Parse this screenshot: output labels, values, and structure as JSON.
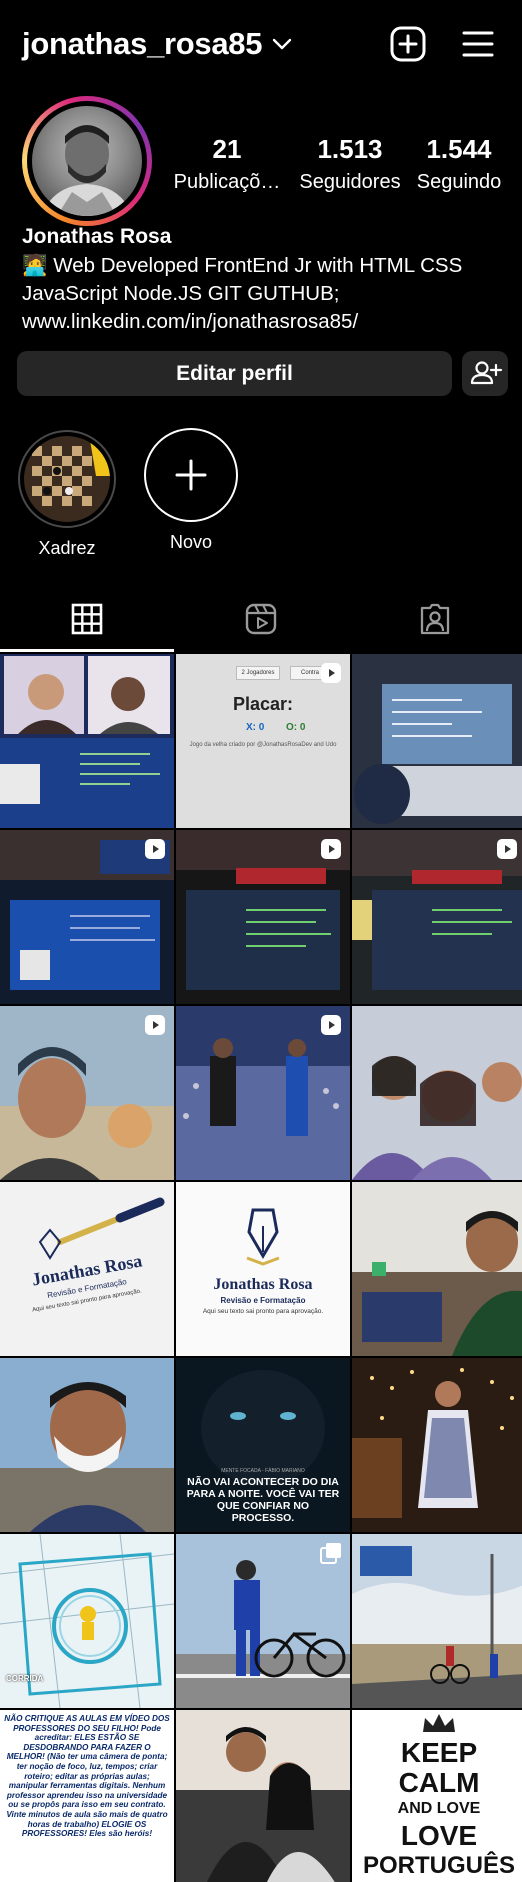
{
  "header": {
    "username": "jonathas_rosa85"
  },
  "profile": {
    "name": "Jonathas Rosa",
    "bio_line1": "🧑‍💻 Web Developed FrontEnd Jr with HTML CSS",
    "bio_line2": "JavaScript Node.JS GIT GUTHUB;",
    "link": "www.linkedin.com/in/jonathasrosa85/",
    "stats": [
      {
        "value": "21",
        "label": "Publicaçõ…"
      },
      {
        "value": "1.513",
        "label": "Seguidores"
      },
      {
        "value": "1.544",
        "label": "Seguindo"
      }
    ]
  },
  "actions": {
    "edit_label": "Editar perfil"
  },
  "highlights": [
    {
      "label": "Xadrez"
    },
    {
      "label": "Novo"
    }
  ],
  "posts": {
    "placar_title": "Placar:",
    "placar_x": "X: 0",
    "placar_o": "O: 0",
    "placar_credit": "Jogo da velha criado por @JonathasRosaDev and Udo",
    "placar_btn1": "2 Jogadores",
    "placar_btn2": "Contra",
    "brand_name": "Jonathas Rosa",
    "brand_sub": "Revisão e Formatação",
    "brand_tag": "Aqui seu texto sai pronto para aprovação.",
    "panther_text": "NÃO VAI ACONTECER DO DIA PARA A NOITE. VOCÊ VAI TER QUE CONFIAR NO PROCESSO.",
    "panther_author": "MENTE FOCADA - FÁBIO MARIANO",
    "run_label": "CORRIDA",
    "quote_text": "NÃO CRITIQUE AS AULAS EM VÍDEO DOS PROFESSORES DO SEU FILHO! Pode acreditar: ELES ESTÃO SE DESDOBRANDO PARA FAZER O MELHOR! (Não ter uma câmera de ponta; ter noção de foco, luz, tempos; criar roteiro; editar as próprias aulas; manipular ferramentas digitais. Nenhum professor aprendeu isso na universidade ou se propôs para isso em seu contrato. Vinte minutos de aula são mais de quatro horas de trabalho) ELOGIE OS PROFESSORES! Eles são heróis!",
    "keep1": "KEEP",
    "keep2": "CALM",
    "keep3": "AND LOVE",
    "keep4": "LOVE",
    "keep5": "PORTUGUÊS"
  }
}
